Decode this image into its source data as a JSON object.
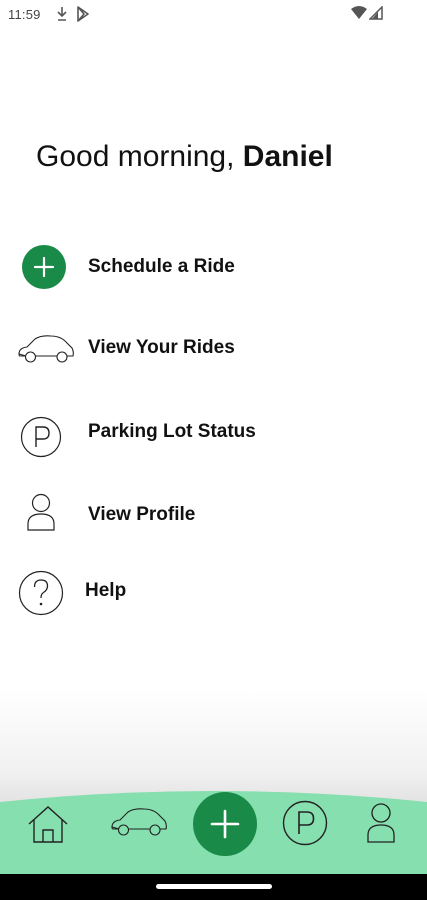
{
  "status_bar": {
    "time": "11:59",
    "left_icons": [
      "download-icon",
      "play-store-icon"
    ],
    "right_icons": [
      "wifi-icon",
      "signal-icon"
    ]
  },
  "greeting": {
    "prefix": "Good morning, ",
    "name": "Daniel"
  },
  "menu": {
    "items": [
      {
        "label": "Schedule a Ride",
        "icon": "add-circle-icon"
      },
      {
        "label": "View Your Rides",
        "icon": "car-icon"
      },
      {
        "label": "Parking Lot Status",
        "icon": "parking-icon"
      },
      {
        "label": "View Profile",
        "icon": "person-icon"
      },
      {
        "label": "Help",
        "icon": "help-icon"
      }
    ]
  },
  "bottom_nav": {
    "items": [
      "home-icon",
      "car-icon",
      "add-circle-icon",
      "parking-icon",
      "person-icon"
    ]
  },
  "colors": {
    "accent": "#1a8a48",
    "nav_background": "#86dfae",
    "text": "#111111"
  }
}
